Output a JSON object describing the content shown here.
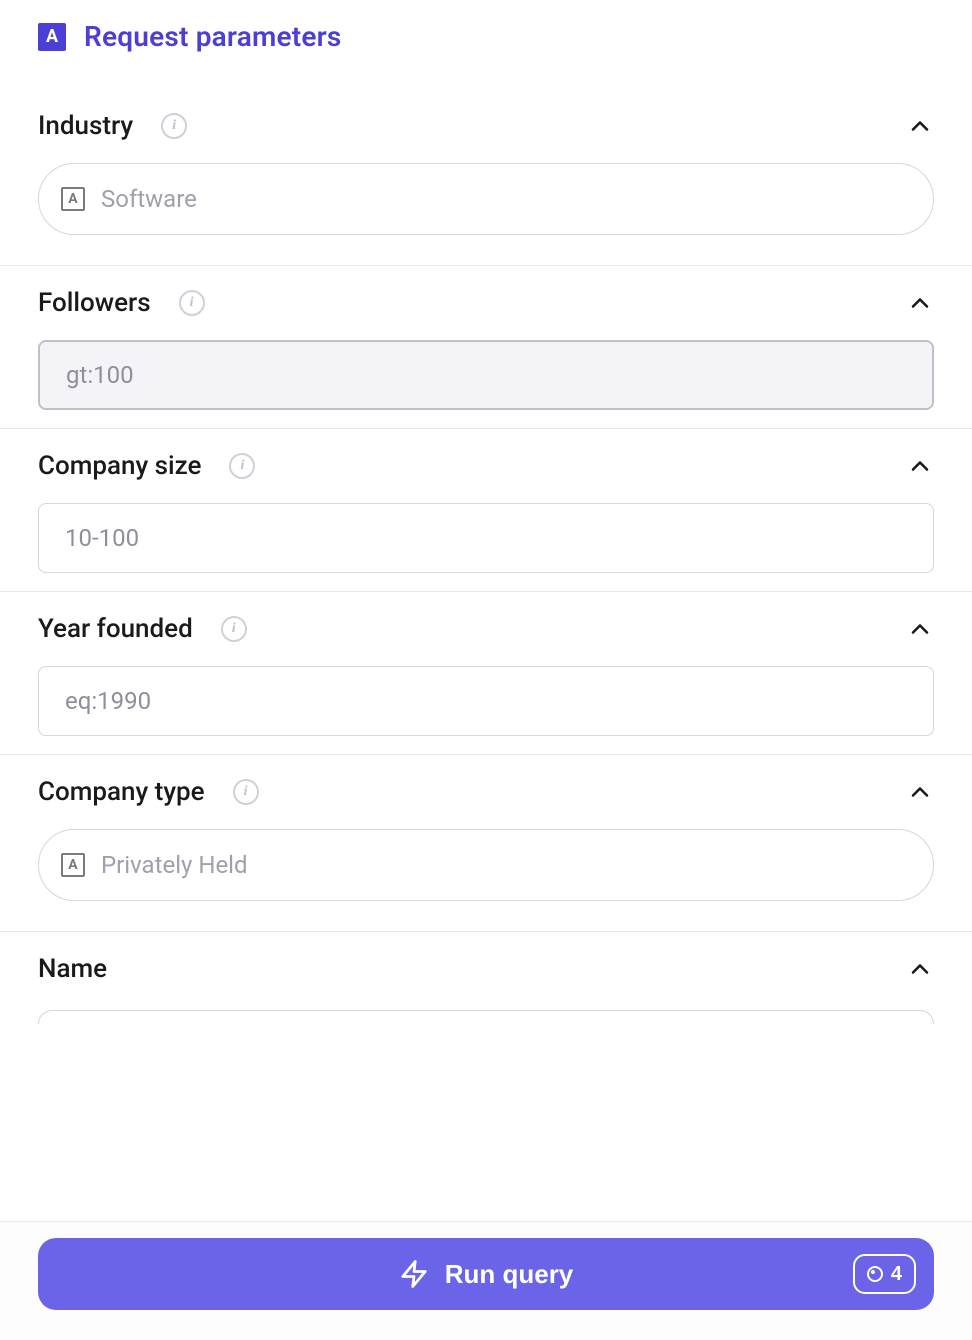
{
  "header": {
    "badge_letter": "A",
    "title": "Request parameters"
  },
  "fields": {
    "industry": {
      "label": "Industry",
      "placeholder": "Software",
      "leading_letter": "A"
    },
    "followers": {
      "label": "Followers",
      "placeholder": "gt:100"
    },
    "company_size": {
      "label": "Company size",
      "placeholder": "10-100"
    },
    "year_founded": {
      "label": "Year founded",
      "placeholder": "eq:1990"
    },
    "company_type": {
      "label": "Company type",
      "placeholder": "Privately Held",
      "leading_letter": "A"
    },
    "name": {
      "label": "Name"
    }
  },
  "footer": {
    "button_label": "Run query",
    "credit_count": "4"
  },
  "info_glyph": "i"
}
